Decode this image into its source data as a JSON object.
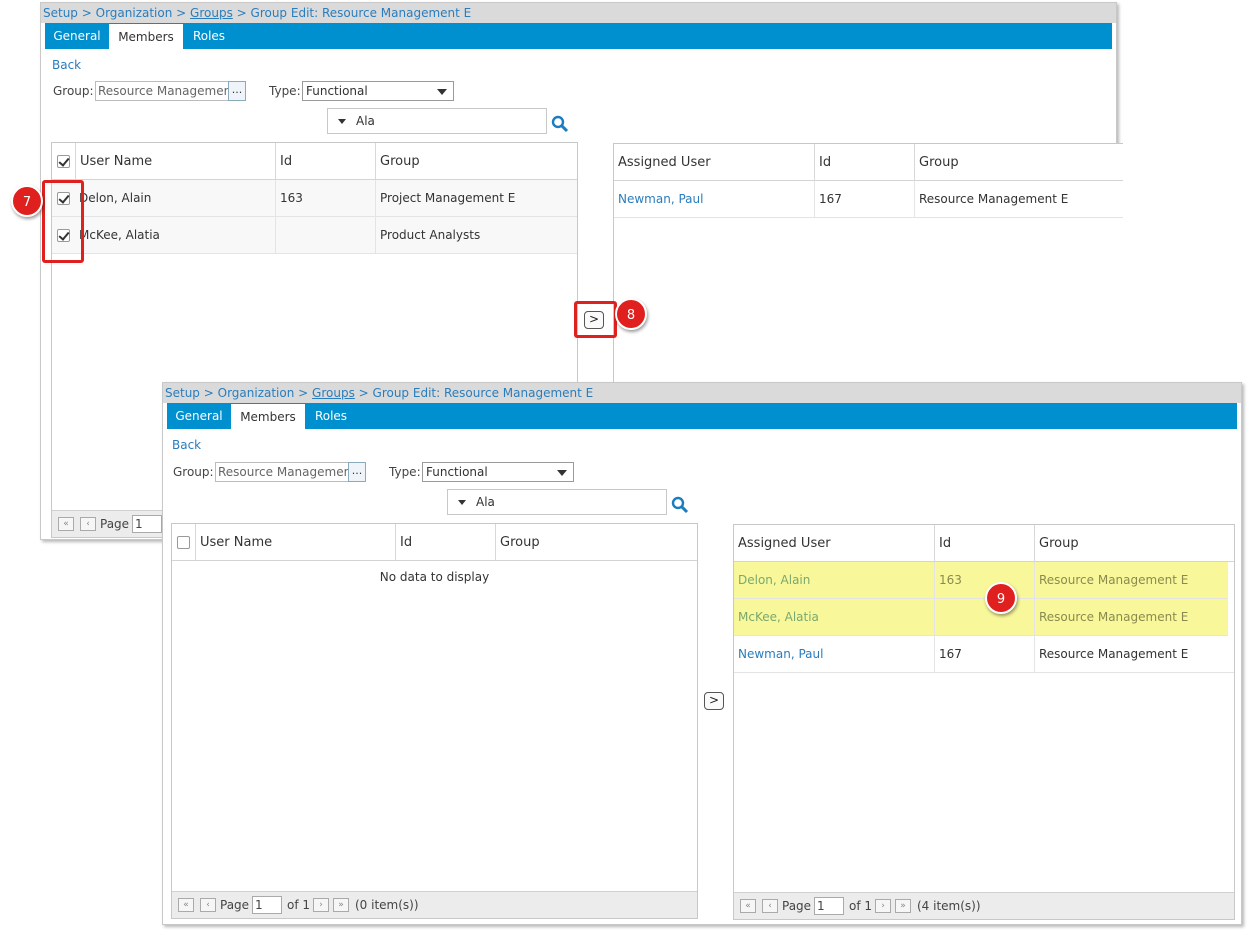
{
  "breadcrumb": {
    "setup": "Setup",
    "sep": " > ",
    "organization": "Organization",
    "groups": "Groups",
    "current": "Group Edit: Resource Management E"
  },
  "tabs": [
    "General",
    "Members",
    "Roles"
  ],
  "back_label": "Back",
  "group_label": "Group:",
  "group_value": "Resource Management",
  "group_picker": "...",
  "type_label": "Type:",
  "type_value": "Functional",
  "search_value": "Ala",
  "left_columns": [
    "User Name",
    "Id",
    "Group"
  ],
  "right_columns": [
    "Assigned User",
    "Id",
    "Group"
  ],
  "panel1": {
    "left_rows": [
      {
        "name": "Delon, Alain",
        "id": "163",
        "group": "Project Management E"
      },
      {
        "name": "McKee, Alatia",
        "id": "",
        "group": "Product Analysts"
      }
    ],
    "right_rows": [
      {
        "name": "Newman, Paul",
        "id": "167",
        "group": "Resource Management E"
      }
    ],
    "page_label": "Page",
    "page_value": "1"
  },
  "panel2": {
    "no_data": "No data to display",
    "right_rows": [
      {
        "name": "Delon, Alain",
        "id": "163",
        "group": "Resource Management E"
      },
      {
        "name": "McKee, Alatia",
        "id": "",
        "group": "Resource Management E"
      },
      {
        "name": "Newman, Paul",
        "id": "167",
        "group": "Resource Management E"
      }
    ],
    "left_pager": {
      "page": "Page",
      "value": "1",
      "of": "of 1",
      "items": "(0 item(s))"
    },
    "right_pager": {
      "page": "Page",
      "value": "1",
      "of": "of 1",
      "items": "(4 item(s))"
    }
  },
  "move_button": ">",
  "steps": [
    "7",
    "8",
    "9"
  ],
  "colors": {
    "tab_bar": "#0090d0",
    "link": "#2a7dbd",
    "highlight": "#f8f89a",
    "callout": "#e0201e"
  }
}
